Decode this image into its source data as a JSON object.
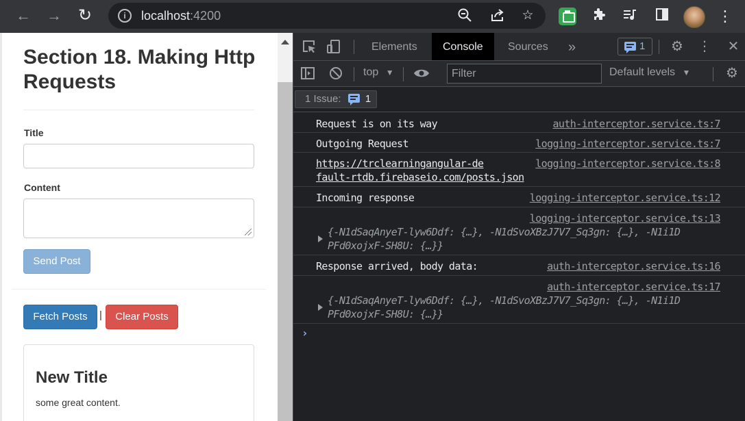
{
  "browser": {
    "url_host": "localhost",
    "url_port": ":4200",
    "icons": {
      "back": "arrow-left-icon",
      "forward": "arrow-right-icon",
      "reload": "reload-icon",
      "info": "info-icon",
      "zoom": "zoom-out-icon",
      "share": "share-icon",
      "bookmark": "star-icon",
      "extension": "puzzle-icon",
      "media": "media-queue-icon",
      "sidepanel": "side-panel-icon",
      "menu": "kebab-menu-icon"
    }
  },
  "page": {
    "title": "Section 18. Making Http Requests",
    "form": {
      "title_label": "Title",
      "title_value": "",
      "content_label": "Content",
      "content_value": "",
      "send_label": "Send Post"
    },
    "actions": {
      "fetch_label": "Fetch Posts",
      "separator": "|",
      "clear_label": "Clear Posts"
    },
    "post": {
      "title": "New Title",
      "content": "some great content."
    }
  },
  "devtools": {
    "tabs": [
      "Elements",
      "Console",
      "Sources"
    ],
    "active_tab": "Console",
    "more_tabs": "»",
    "issue_count": "1",
    "context": "top",
    "filter_placeholder": "Filter",
    "levels": "Default levels",
    "issues_label": "1 Issue:",
    "issues_count": "1",
    "console": [
      {
        "text": "Request is on its way",
        "source": "auth-interceptor.service.ts:7"
      },
      {
        "text": "Outgoing Request",
        "source": "logging-interceptor.service.ts:7"
      },
      {
        "text_line1": "https://trclearningangular-de",
        "text_line2": "fault-rtdb.firebaseio.com/posts.json",
        "source": "logging-interceptor.service.ts:8"
      },
      {
        "text": "Incoming response",
        "source": "logging-interceptor.service.ts:12"
      },
      {
        "source": "logging-interceptor.service.ts:13",
        "obj_line1": "{-N1dSaqAnyeT-lyw6Ddf: {…}, -N1dSvoXBzJ7V7_Sq3gn: {…}, -N1i1D",
        "obj_line2": "PFd0xojxF-SH8U: {…}}"
      },
      {
        "text": "Response arrived, body data:",
        "source": "auth-interceptor.service.ts:16"
      },
      {
        "source": "auth-interceptor.service.ts:17",
        "obj_line1": "{-N1dSaqAnyeT-lyw6Ddf: {…}, -N1dSvoXBzJ7V7_Sq3gn: {…}, -N1i1D",
        "obj_line2": "PFd0xojxF-SH8U: {…}}"
      }
    ],
    "prompt": "›"
  }
}
